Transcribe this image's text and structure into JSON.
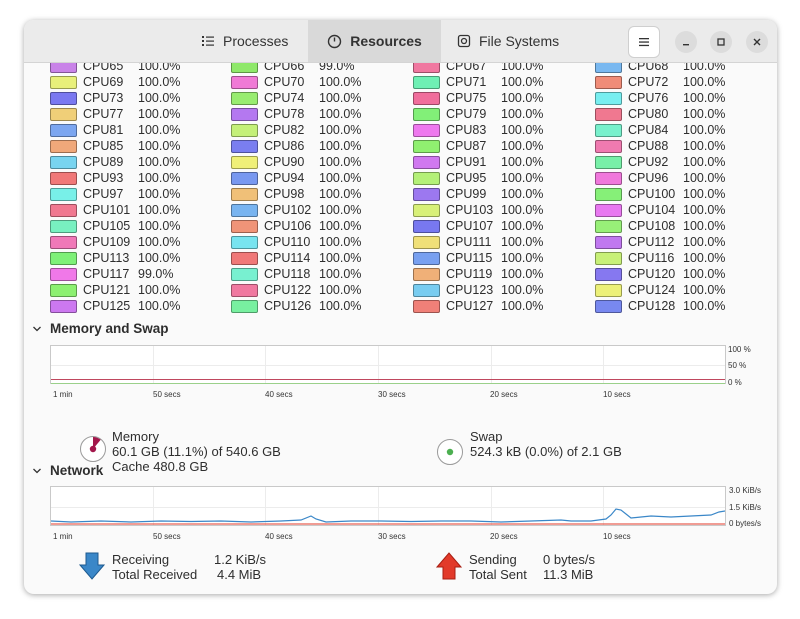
{
  "tabs": [
    {
      "label": "Processes",
      "icon": "list-icon"
    },
    {
      "label": "Resources",
      "icon": "gauge-icon"
    },
    {
      "label": "File Systems",
      "icon": "disk-icon"
    }
  ],
  "cpu_rows": [
    [
      [
        "CPU65",
        "100.0%",
        "#c983e8"
      ],
      [
        "CPU66",
        "99.0%",
        "#8fe86a"
      ],
      [
        "CPU67",
        "100.0%",
        "#f078a0"
      ],
      [
        "CPU68",
        "100.0%",
        "#79b8f0"
      ]
    ],
    [
      [
        "CPU69",
        "100.0%",
        "#e8f07a"
      ],
      [
        "CPU70",
        "100.0%",
        "#f07ad6"
      ],
      [
        "CPU71",
        "100.0%",
        "#6ef0b4"
      ],
      [
        "CPU72",
        "100.0%",
        "#f08c78"
      ]
    ],
    [
      [
        "CPU73",
        "100.0%",
        "#7a78f0"
      ],
      [
        "CPU74",
        "100.0%",
        "#98ec70"
      ],
      [
        "CPU75",
        "100.0%",
        "#f06e9c"
      ],
      [
        "CPU76",
        "100.0%",
        "#78eef0"
      ]
    ],
    [
      [
        "CPU77",
        "100.0%",
        "#f0cf78"
      ],
      [
        "CPU78",
        "100.0%",
        "#b478f0"
      ],
      [
        "CPU79",
        "100.0%",
        "#82f078"
      ],
      [
        "CPU80",
        "100.0%",
        "#f07890"
      ]
    ],
    [
      [
        "CPU81",
        "100.0%",
        "#7ca6f0"
      ],
      [
        "CPU82",
        "100.0%",
        "#c4f078"
      ],
      [
        "CPU83",
        "100.0%",
        "#ee78ee"
      ],
      [
        "CPU84",
        "100.0%",
        "#78f0cc"
      ]
    ],
    [
      [
        "CPU85",
        "100.0%",
        "#f0a87a"
      ],
      [
        "CPU86",
        "100.0%",
        "#7a7ef0"
      ],
      [
        "CPU87",
        "100.0%",
        "#90f070"
      ],
      [
        "CPU88",
        "100.0%",
        "#f07ab0"
      ]
    ],
    [
      [
        "CPU89",
        "100.0%",
        "#78d4f0"
      ],
      [
        "CPU90",
        "100.0%",
        "#f0f078"
      ],
      [
        "CPU91",
        "100.0%",
        "#d078f0"
      ],
      [
        "CPU92",
        "100.0%",
        "#78f0a8"
      ]
    ],
    [
      [
        "CPU93",
        "100.0%",
        "#f07878"
      ],
      [
        "CPU94",
        "100.0%",
        "#7898f0"
      ],
      [
        "CPU95",
        "100.0%",
        "#b4f078"
      ],
      [
        "CPU96",
        "100.0%",
        "#f078dc"
      ]
    ],
    [
      [
        "CPU97",
        "100.0%",
        "#78f0e8"
      ],
      [
        "CPU98",
        "100.0%",
        "#f0c078"
      ],
      [
        "CPU99",
        "100.0%",
        "#9c78f0"
      ],
      [
        "CPU100",
        "100.0%",
        "#86f078"
      ]
    ],
    [
      [
        "CPU101",
        "100.0%",
        "#f07890"
      ],
      [
        "CPU102",
        "100.0%",
        "#78b4f0"
      ],
      [
        "CPU103",
        "100.0%",
        "#d8f078"
      ],
      [
        "CPU104",
        "100.0%",
        "#e878f0"
      ]
    ],
    [
      [
        "CPU105",
        "100.0%",
        "#78f0c0"
      ],
      [
        "CPU106",
        "100.0%",
        "#f09478"
      ],
      [
        "CPU107",
        "100.0%",
        "#7878f0"
      ],
      [
        "CPU108",
        "100.0%",
        "#98f078"
      ]
    ],
    [
      [
        "CPU109",
        "100.0%",
        "#f078b8"
      ],
      [
        "CPU110",
        "100.0%",
        "#78e4f0"
      ],
      [
        "CPU111",
        "100.0%",
        "#f0e078"
      ],
      [
        "CPU112",
        "100.0%",
        "#c078f0"
      ]
    ],
    [
      [
        "CPU113",
        "100.0%",
        "#7ef078"
      ],
      [
        "CPU114",
        "100.0%",
        "#f07878"
      ],
      [
        "CPU115",
        "100.0%",
        "#78a0f0"
      ],
      [
        "CPU116",
        "100.0%",
        "#c8f078"
      ]
    ],
    [
      [
        "CPU117",
        "99.0%",
        "#f078e8"
      ],
      [
        "CPU118",
        "100.0%",
        "#78f0d0"
      ],
      [
        "CPU119",
        "100.0%",
        "#f0b078"
      ],
      [
        "CPU120",
        "100.0%",
        "#8678f0"
      ]
    ],
    [
      [
        "CPU121",
        "100.0%",
        "#8cf070"
      ],
      [
        "CPU122",
        "100.0%",
        "#f078a0"
      ],
      [
        "CPU123",
        "100.0%",
        "#78ccf0"
      ],
      [
        "CPU124",
        "100.0%",
        "#ecf078"
      ]
    ],
    [
      [
        "CPU125",
        "100.0%",
        "#cc78f0"
      ],
      [
        "CPU126",
        "100.0%",
        "#78f0a0"
      ],
      [
        "CPU127",
        "100.0%",
        "#f08078"
      ],
      [
        "CPU128",
        "100.0%",
        "#7888f0"
      ]
    ]
  ],
  "memory_section": {
    "title": "Memory and Swap",
    "x_ticks": [
      "1 min",
      "50 secs",
      "40 secs",
      "30 secs",
      "20 secs",
      "10 secs"
    ],
    "y_ticks": [
      "100 %",
      "50 %",
      "0 %"
    ],
    "memory": {
      "label": "Memory",
      "line1": "60.1 GB (11.1%) of 540.6 GB",
      "line2": "Cache 480.8 GB",
      "fraction": 0.111,
      "color": "#a3174b"
    },
    "swap": {
      "label": "Swap",
      "line1": "524.3 kB (0.0%) of 2.1 GB",
      "fraction": 0.0,
      "color": "#4caf50"
    }
  },
  "network_section": {
    "title": "Network",
    "x_ticks": [
      "1 min",
      "50 secs",
      "40 secs",
      "30 secs",
      "20 secs",
      "10 secs"
    ],
    "y_ticks": [
      "3.0 KiB/s",
      "1.5 KiB/s",
      "0 bytes/s"
    ],
    "receiving": {
      "label": "Receiving",
      "value": "1.2 KiB/s",
      "total_label": "Total Received",
      "total": "4.4 MiB",
      "color": "#3a87c8"
    },
    "sending": {
      "label": "Sending",
      "value": "0 bytes/s",
      "total_label": "Total Sent",
      "total": "11.3 MiB",
      "color": "#e23a2a"
    }
  }
}
